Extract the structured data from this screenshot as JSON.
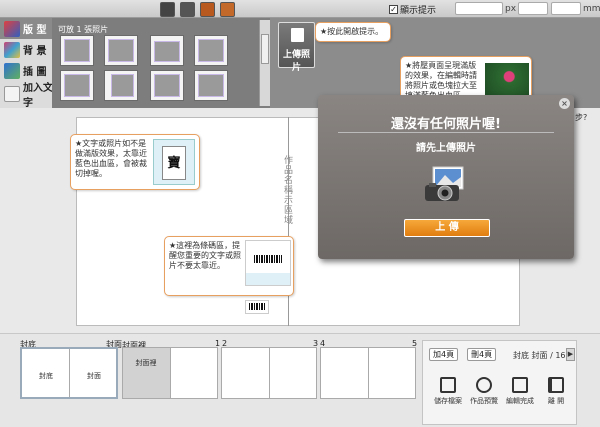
{
  "toolbar": {
    "show_hints_label": "顯示提示",
    "unit_px": "px",
    "unit_mm": "mm"
  },
  "nav": {
    "items": [
      {
        "label": "版 型",
        "icon": "layout-icon"
      },
      {
        "label": "背 景",
        "icon": "background-icon"
      },
      {
        "label": "插 圖",
        "icon": "clipart-icon"
      },
      {
        "label": "加入文字",
        "icon": "add-text-icon"
      }
    ]
  },
  "strip": {
    "caption": "可放 1 張照片"
  },
  "upload": {
    "button_label": "上傳照片",
    "tip": "★按此開啟提示。"
  },
  "tips": {
    "compress": "★將壓頁面呈現滿版的效果，在編輯時請將照片或色塊拉大至填滿藍色出血區",
    "outside_text": "★文字或照片如不是做滿版效果，太靠近藍色出血區，會被裁切掉喔。",
    "barcode": "★這裡為條碼區，提醒您重要的文字或照片不要太靠近。",
    "sample_char": "寶"
  },
  "canvas": {
    "spine_label": "作品名稱示區域",
    "partial_tip": "步?"
  },
  "dialog": {
    "title": "還沒有任何照片喔!",
    "subtitle": "請先上傳照片",
    "upload_button": "上 傳",
    "close": "×"
  },
  "pages": {
    "back_cover": "封底",
    "front_cover": "封面",
    "inside_cover": "封面裡",
    "p1": "1",
    "p2": "2",
    "p3": "3",
    "p4": "4",
    "p5": "5",
    "box_back": "封底",
    "box_front": "封面",
    "box_inside": "封面裡"
  },
  "controls": {
    "add_pages": "加4頁",
    "delete_pages": "刪4頁",
    "page_indicator": "封底 封面 / 16",
    "next": "▶",
    "actions": [
      {
        "label": "儲存檔案",
        "icon": "save-icon"
      },
      {
        "label": "作品預覽",
        "icon": "preview-icon"
      },
      {
        "label": "編輯完成",
        "icon": "finish-edit-icon"
      },
      {
        "label": "離 開",
        "icon": "exit-icon"
      }
    ]
  }
}
